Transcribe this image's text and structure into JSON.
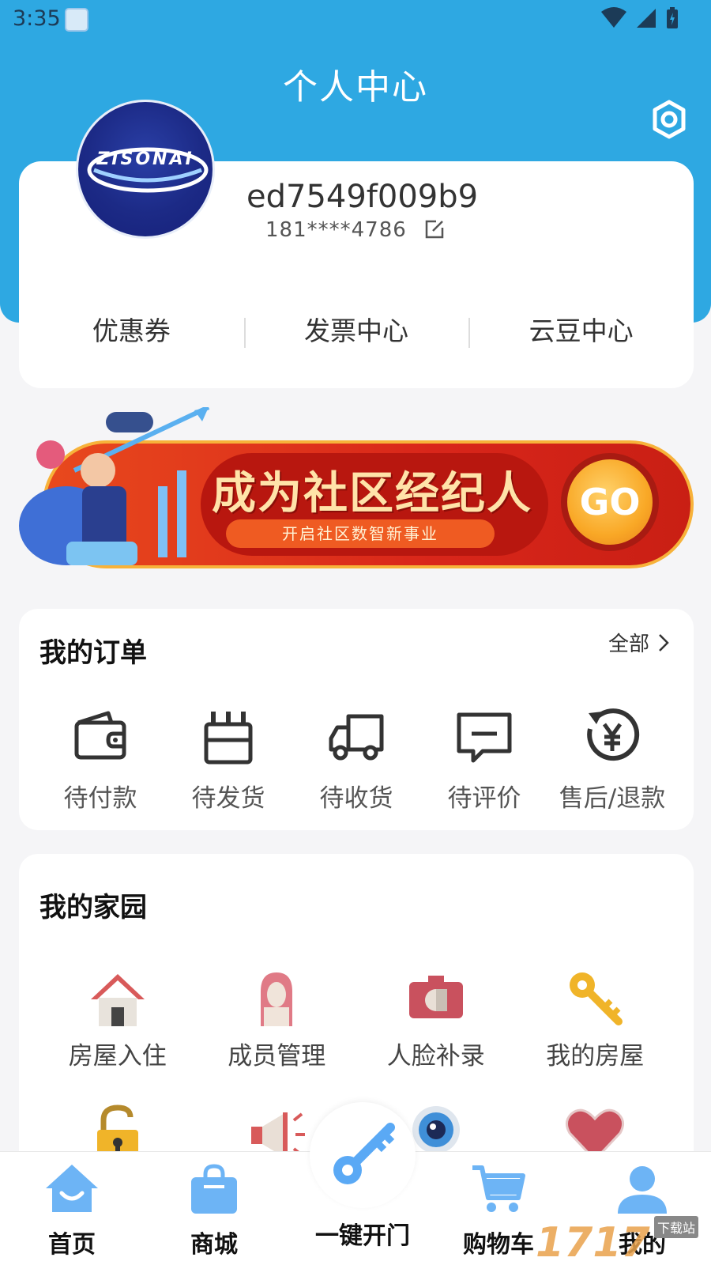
{
  "status_bar": {
    "time": "3:35"
  },
  "header": {
    "title": "个人中心"
  },
  "profile": {
    "avatar_text": "ZISONAI",
    "username": "ed7549f009b9",
    "phone": "181****4786"
  },
  "quick_links": [
    {
      "label": "优惠券"
    },
    {
      "label": "发票中心"
    },
    {
      "label": "云豆中心"
    }
  ],
  "banner": {
    "title": "成为社区经纪人",
    "subtitle": "开启社区数智新事业",
    "cta": "GO"
  },
  "orders": {
    "title": "我的订单",
    "all_label": "全部",
    "items": [
      {
        "label": "待付款",
        "icon": "wallet-icon"
      },
      {
        "label": "待发货",
        "icon": "package-icon"
      },
      {
        "label": "待收货",
        "icon": "truck-icon"
      },
      {
        "label": "待评价",
        "icon": "comment-icon"
      },
      {
        "label": "售后/退款",
        "icon": "refund-icon"
      }
    ]
  },
  "home": {
    "title": "我的家园",
    "items": [
      {
        "label": "房屋入住",
        "icon": "house-icon"
      },
      {
        "label": "成员管理",
        "icon": "member-icon"
      },
      {
        "label": "人脸补录",
        "icon": "camera-icon"
      },
      {
        "label": "我的房屋",
        "icon": "key-icon"
      },
      {
        "label": "",
        "icon": "lock-icon"
      },
      {
        "label": "",
        "icon": "megaphone-icon"
      },
      {
        "label": "",
        "icon": "webcam-icon"
      },
      {
        "label": "",
        "icon": "heart-icon"
      }
    ]
  },
  "bottom_nav": {
    "items": [
      {
        "label": "首页",
        "icon": "home-icon"
      },
      {
        "label": "商城",
        "icon": "shop-icon"
      },
      {
        "label": "一键开门",
        "icon": "door-key-icon"
      },
      {
        "label": "购物车",
        "icon": "cart-icon"
      },
      {
        "label": "我的",
        "icon": "user-icon"
      }
    ]
  },
  "watermark": {
    "text": "1717",
    "sub": "下载站"
  },
  "colors": {
    "header": "#2ea8e2",
    "nav_accent": "#5aa9f5",
    "banner_red": "#d9261a",
    "banner_gold": "#f9a826"
  }
}
